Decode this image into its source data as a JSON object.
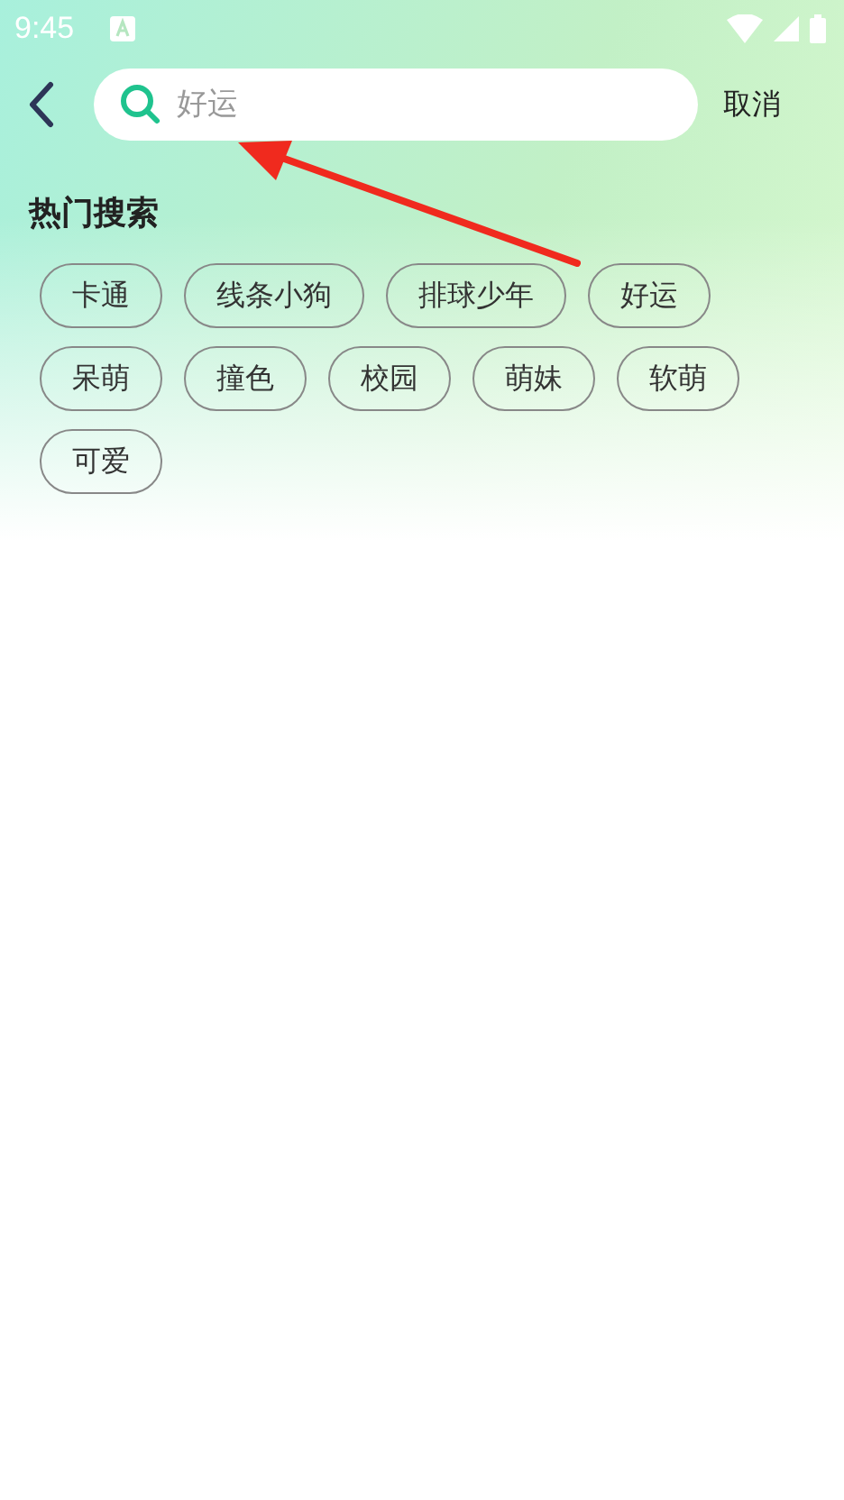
{
  "status_bar": {
    "time": "9:45"
  },
  "search": {
    "placeholder": "好运",
    "cancel": "取消"
  },
  "hot_search": {
    "title": "热门搜索",
    "tags": [
      "卡通",
      "线条小狗",
      "排球少年",
      "好运",
      "呆萌",
      "撞色",
      "校园",
      "萌妹",
      "软萌",
      "可爱"
    ]
  }
}
